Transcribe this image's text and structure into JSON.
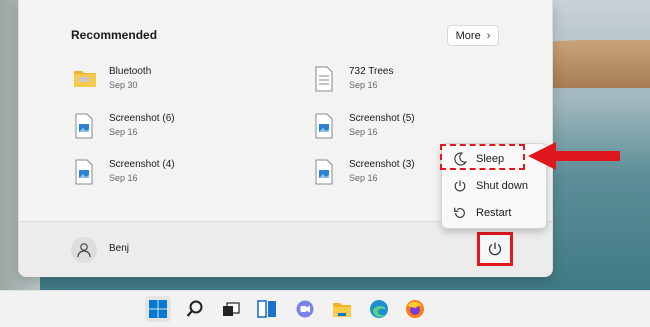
{
  "start_menu": {
    "recommended_title": "Recommended",
    "more_label": "More",
    "items": [
      {
        "name": "Bluetooth",
        "date": "Sep 30",
        "icon": "folder-icon"
      },
      {
        "name": "732 Trees",
        "date": "Sep 16",
        "icon": "document-icon"
      },
      {
        "name": "Screenshot (6)",
        "date": "Sep 16",
        "icon": "image-file-icon"
      },
      {
        "name": "Screenshot (5)",
        "date": "Sep 16",
        "icon": "image-file-icon"
      },
      {
        "name": "Screenshot (4)",
        "date": "Sep 16",
        "icon": "image-file-icon"
      },
      {
        "name": "Screenshot (3)",
        "date": "Sep 16",
        "icon": "image-file-icon"
      }
    ],
    "user": {
      "name": "Benj"
    }
  },
  "power_menu": {
    "items": [
      {
        "label": "Sleep",
        "icon": "moon-icon"
      },
      {
        "label": "Shut down",
        "icon": "power-icon"
      },
      {
        "label": "Restart",
        "icon": "restart-icon"
      }
    ]
  },
  "taskbar": {
    "icons": [
      "windows-start-icon",
      "search-icon",
      "task-view-icon",
      "widgets-icon",
      "teams-chat-icon",
      "file-explorer-icon",
      "edge-icon",
      "firefox-icon"
    ]
  },
  "colors": {
    "highlight": "#e0181e",
    "accent": "#0078d4"
  }
}
